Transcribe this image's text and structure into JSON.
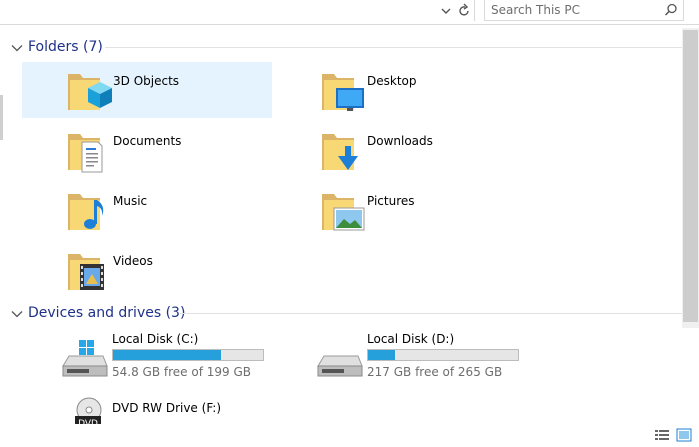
{
  "search": {
    "placeholder": "Search This PC"
  },
  "groups": {
    "folders": {
      "title": "Folders (7)"
    },
    "devices": {
      "title": "Devices and drives (3)"
    }
  },
  "folders": [
    {
      "label": "3D Objects",
      "icon": "3d-objects-folder-icon"
    },
    {
      "label": "Desktop",
      "icon": "desktop-folder-icon"
    },
    {
      "label": "Documents",
      "icon": "documents-folder-icon"
    },
    {
      "label": "Downloads",
      "icon": "downloads-folder-icon"
    },
    {
      "label": "Music",
      "icon": "music-folder-icon"
    },
    {
      "label": "Pictures",
      "icon": "pictures-folder-icon"
    },
    {
      "label": "Videos",
      "icon": "videos-folder-icon"
    }
  ],
  "drives": [
    {
      "label": "Local Disk (C:)",
      "free": "54.8 GB free of 199 GB",
      "used_fraction": 0.72,
      "icon": "windows-disk-icon"
    },
    {
      "label": "Local Disk (D:)",
      "free": "217 GB free of 265 GB",
      "used_fraction": 0.18,
      "icon": "disk-icon"
    },
    {
      "label": "DVD RW Drive (F:)",
      "icon": "dvd-drive-icon"
    }
  ],
  "colors": {
    "accent": "#1e3287",
    "selection": "#e5f3ff",
    "bar_fill": "#26a0da"
  }
}
